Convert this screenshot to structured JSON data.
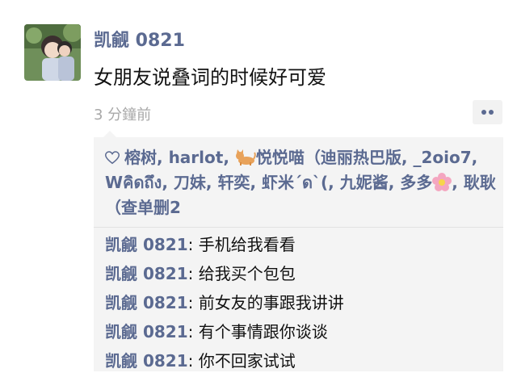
{
  "post": {
    "author": "凯觎 0821",
    "text": "女朋友说叠词的时候好可爱",
    "timestamp": "3 分鐘前"
  },
  "likes": {
    "icon": "heart-outline-icon",
    "names": [
      "榕树",
      "harlot",
      "悦悦喵（迪丽热巴版",
      "_2oio7",
      "Wคิดถึง",
      "刀妹",
      "轩奕",
      "虾米´ด`(",
      "九妮酱",
      "多多",
      "耿耿（查单删2"
    ]
  },
  "comments": [
    {
      "author": "凯觎 0821",
      "text": "手机给我看看"
    },
    {
      "author": "凯觎 0821",
      "text": "给我买个包包"
    },
    {
      "author": "凯觎 0821",
      "text": "前女友的事跟我讲讲"
    },
    {
      "author": "凯觎 0821",
      "text": "有个事情跟你谈谈"
    },
    {
      "author": "凯觎 0821",
      "text": "你不回家试试"
    }
  ],
  "colors": {
    "name": "#5b6a91",
    "timestamp": "#a8a8a8",
    "panel": "#f4f4f4"
  }
}
